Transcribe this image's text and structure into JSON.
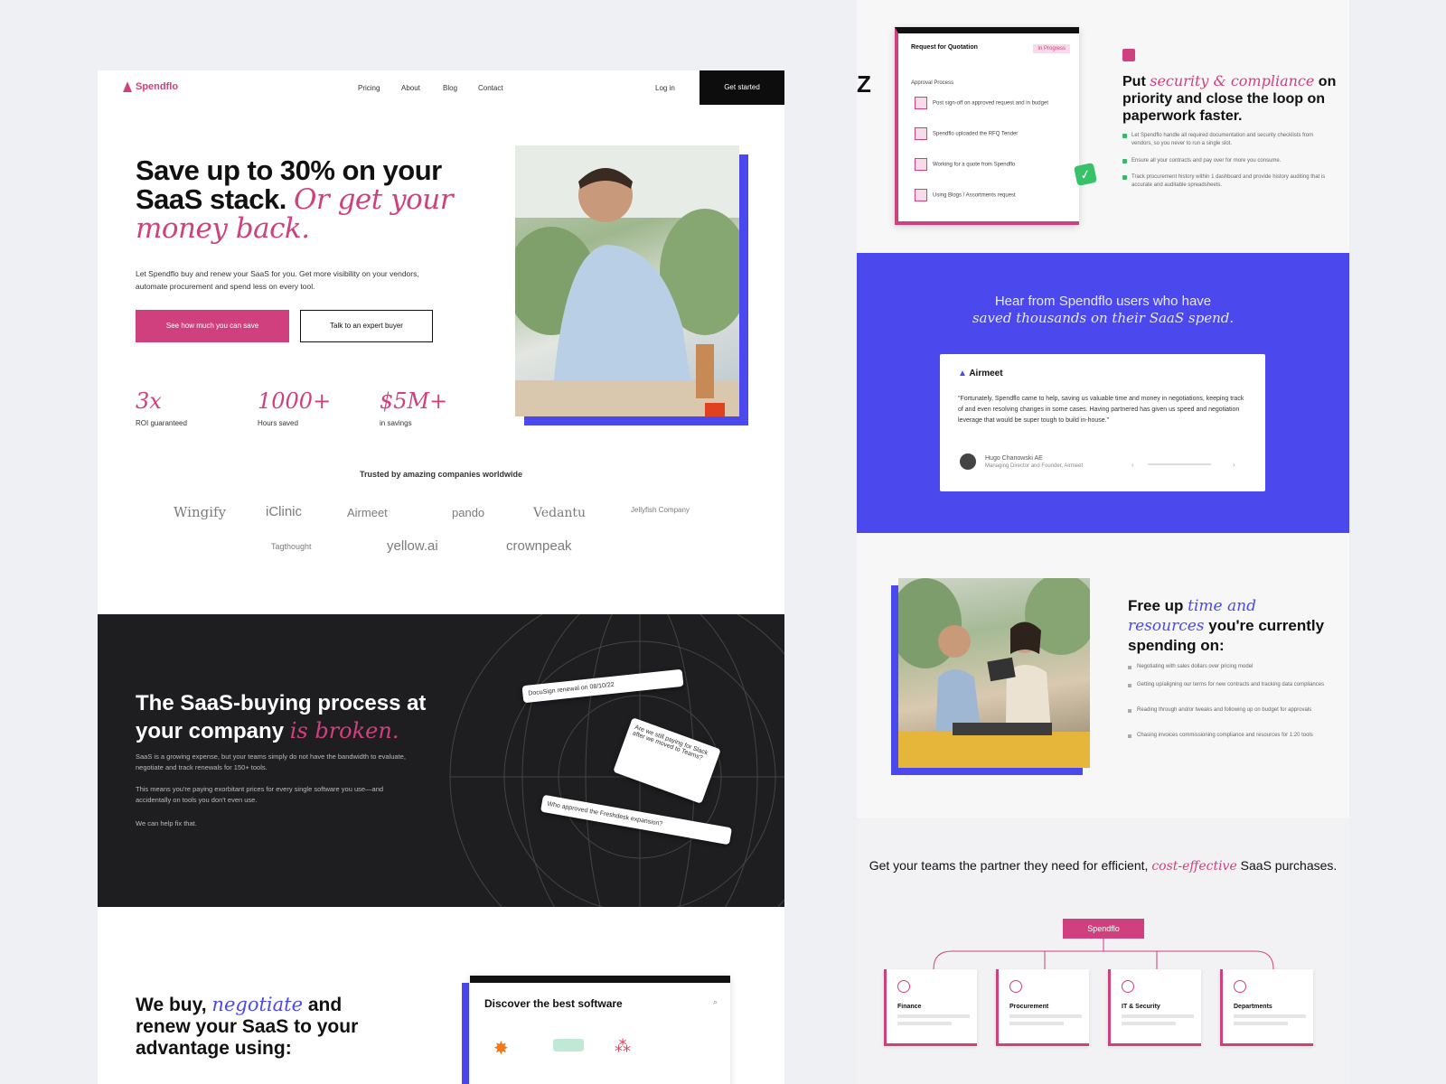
{
  "left": {
    "nav": {
      "brand": "Spendflo",
      "links": [
        "Pricing",
        "About",
        "Blog",
        "Contact"
      ],
      "login": "Log in",
      "cta": "Get started"
    },
    "hero": {
      "title_a": "Save up to 30% on your SaaS stack.",
      "title_b": "Or get your money back.",
      "desc": "Let Spendflo buy and renew your SaaS for you. Get more visibility on your vendors, automate procurement and spend less on every tool.",
      "btn_primary": "See how much you can save",
      "btn_secondary": "Talk to an expert buyer",
      "stats": [
        {
          "value": "3x",
          "label": "ROI guaranteed"
        },
        {
          "value": "1000+",
          "label": "Hours saved"
        },
        {
          "value": "$5M+",
          "label": "in savings"
        }
      ]
    },
    "trusted": {
      "title": "Trusted by amazing companies worldwide",
      "logos": [
        "Wingify",
        "iClinic",
        "Airmeet",
        "pando",
        "Vedantu",
        "Jellyfish Company",
        "Tagthought",
        "yellow.ai",
        "crownpeak"
      ]
    },
    "broken": {
      "title_a": "The SaaS-buying process at your company",
      "title_b": "is broken.",
      "p1": "SaaS is a growing expense, but your teams simply do not have the bandwidth to evaluate, negotiate and track renewals for 150+ tools.",
      "p2": "This means you're paying exorbitant prices for every single software you use—and accidentally on tools you don't even use.",
      "p3": "We can help fix that.",
      "card1": "DocuSign renewal on 08/10/22",
      "card2": "Are we still paying for Slack after we moved to Teams?",
      "card3": "Who approved the Freshdesk expansion?"
    },
    "we_buy": {
      "title_a": "We buy,",
      "title_b": "negotiate",
      "title_c": "and renew your SaaS to your advantage using:",
      "discover": "Discover the best software"
    }
  },
  "right": {
    "rfp": {
      "title": "Request for Quotation",
      "badge": "In Progress",
      "section": "Approval Process",
      "rows": [
        "Post sign-off on approved request and in budget",
        "Spendflo uploaded the RFQ Tender",
        "Working for a quote from Spendflo",
        "Using Blogs / Assortments request"
      ]
    },
    "security": {
      "title_a": "Put",
      "title_b": "security & compliance",
      "title_c": "on priority and close the loop on paperwork faster.",
      "points": [
        "Let Spendflo handle all required documentation and security checklists from vendors, so you never to run a single slot.",
        "Ensure all your contracts and pay over for more you consume.",
        "Track procurement history within 1 dashboard and provide history auditing that is accurate and auditable spreadsheets."
      ]
    },
    "testimonial": {
      "heading_a": "Hear from Spendflo users who have",
      "heading_b": "saved thousands on their SaaS spend.",
      "company": "Airmeet",
      "quote": "\"Fortunately, Spendflo came to help, saving us valuable time and money in negotiations, keeping track of and even resolving changes in some cases. Having partnered has given us speed and negotiation leverage that would be super tough to build in-house.\"",
      "author": "Hugo Chanowski AE",
      "role": "Managing Director and Founder, Airmeet"
    },
    "free_up": {
      "title_a": "Free up",
      "title_b": "time and resources",
      "title_c": "you're currently spending on:",
      "points": [
        "Negotiating with sales dollars over pricing model",
        "Getting up/aligning our terms for new contracts and tracking data compliances",
        "Reading through and/or tweaks and following up on budget for approvals",
        "Chasing invoices commissioning compliance and resources for 1:20 tools"
      ]
    },
    "partner": {
      "title_a": "Get your teams the partner they need for efficient,",
      "title_b": "cost-effective",
      "title_c": "SaaS purchases.",
      "badge": "Spendflo",
      "cards": [
        "Finance",
        "Procurement",
        "IT & Security",
        "Departments"
      ]
    }
  }
}
